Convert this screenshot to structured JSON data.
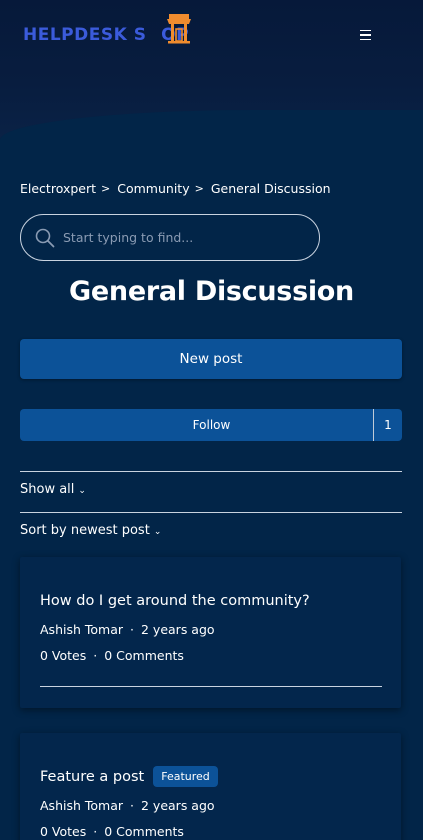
{
  "header": {
    "logo_text_left": "HELPDESK S",
    "logo_text_right": "OP",
    "menu_icon": "hamburger-icon"
  },
  "breadcrumb": {
    "items": [
      "Electroxpert",
      "Community",
      "General Discussion"
    ],
    "separator": ">"
  },
  "search": {
    "placeholder": "Start typing to find...",
    "icon": "search-icon"
  },
  "page": {
    "title": "General Discussion",
    "new_post_label": "New post",
    "follow_label": "Follow",
    "follow_count": "1",
    "show_all_label": "Show all",
    "sort_label": "Sort by newest post"
  },
  "posts": [
    {
      "title": "How do I get around the community?",
      "author": "Ashish Tomar",
      "time": "2 years ago",
      "votes": "0 Votes",
      "comments": "0 Comments",
      "badge": ""
    },
    {
      "title": "Feature a post",
      "author": "Ashish Tomar",
      "time": "2 years ago",
      "votes": "0 Votes",
      "comments": "0 Comments",
      "badge": "Featured"
    }
  ],
  "colors": {
    "background": "#022548",
    "header": "#081d3f",
    "primary": "#0c5298",
    "logo_blue": "#3b5bdb",
    "logo_orange": "#f08c2e"
  }
}
